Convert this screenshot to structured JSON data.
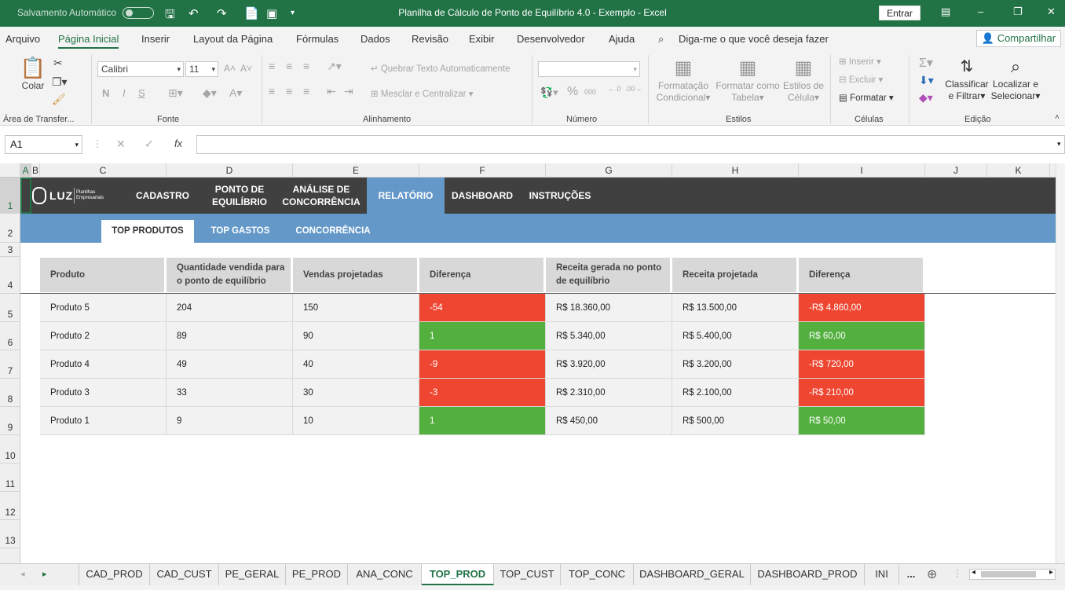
{
  "titlebar": {
    "autosave": "Salvamento Automático",
    "title": "Planilha de Cálculo de Ponto de Equilíbrio 4.0 - Exemplo  -  Excel",
    "enter": "Entrar"
  },
  "menu": {
    "items": [
      "Arquivo",
      "Página Inicial",
      "Inserir",
      "Layout da Página",
      "Fórmulas",
      "Dados",
      "Revisão",
      "Exibir",
      "Desenvolvedor",
      "Ajuda"
    ],
    "tell_me": "Diga-me o que você deseja fazer",
    "share": "Compartilhar"
  },
  "ribbon": {
    "paste": "Colar",
    "font_name": "Calibri",
    "font_size": "11",
    "bold": "N",
    "italic": "I",
    "underline": "S",
    "wrap": "Quebrar Texto Automaticamente",
    "merge": "Mesclar e Centralizar",
    "cond_format": [
      "Formatação",
      "Condicional"
    ],
    "format_table": [
      "Formatar como",
      "Tabela"
    ],
    "cell_styles": [
      "Estilos de",
      "Célula"
    ],
    "insert": "Inserir",
    "delete": "Excluir",
    "format": "Formatar",
    "sort": [
      "Classificar",
      "e Filtrar"
    ],
    "find": [
      "Localizar e",
      "Selecionar"
    ],
    "groups": {
      "clipboard": "Área de Transfer...",
      "font": "Fonte",
      "alignment": "Alinhamento",
      "number": "Número",
      "styles": "Estilos",
      "cells": "Células",
      "editing": "Edição"
    }
  },
  "formula": {
    "namebox": "A1",
    "fx": "fx"
  },
  "columns": [
    "A",
    "B",
    "C",
    "D",
    "E",
    "F",
    "G",
    "H",
    "I",
    "J",
    "K"
  ],
  "rows": [
    "1",
    "2",
    "3",
    "4",
    "5",
    "6",
    "7",
    "8",
    "9",
    "10",
    "11",
    "12",
    "13"
  ],
  "logo": {
    "main": "LUZ",
    "sub1": "Planilhas",
    "sub2": "Empresariais"
  },
  "nav": [
    "CADASTRO",
    "PONTO DE EQUILÍBRIO",
    "ANÁLISE DE CONCORRÊNCIA",
    "RELATÓRIO",
    "DASHBOARD",
    "INSTRUÇÕES"
  ],
  "subnav": [
    "TOP PRODUTOS",
    "TOP GASTOS",
    "CONCORRÊNCIA"
  ],
  "table": {
    "headers": [
      "Produto",
      "Quantidade vendida para o ponto de equilíbrio",
      "Vendas projetadas",
      "Diferença",
      "Receita gerada no ponto de equilíbrio",
      "Receita projetada",
      "Diferença"
    ],
    "rows": [
      [
        "Produto 5",
        "204",
        "150",
        "-54",
        "R$ 18.360,00",
        "R$ 13.500,00",
        "-R$ 4.860,00"
      ],
      [
        "Produto 2",
        "89",
        "90",
        "1",
        "R$ 5.340,00",
        "R$ 5.400,00",
        "R$ 60,00"
      ],
      [
        "Produto 4",
        "49",
        "40",
        "-9",
        "R$ 3.920,00",
        "R$ 3.200,00",
        "-R$ 720,00"
      ],
      [
        "Produto 3",
        "33",
        "30",
        "-3",
        "R$ 2.310,00",
        "R$ 2.100,00",
        "-R$ 210,00"
      ],
      [
        "Produto 1",
        "9",
        "10",
        "1",
        "R$ 450,00",
        "R$ 500,00",
        "R$ 50,00"
      ]
    ]
  },
  "sheets": [
    "CAD_PROD",
    "CAD_CUST",
    "PE_GERAL",
    "PE_PROD",
    "ANA_CONC",
    "TOP_PROD",
    "TOP_CUST",
    "TOP_CONC",
    "DASHBOARD_GERAL",
    "DASHBOARD_PROD",
    "INI",
    "..."
  ],
  "colors": {
    "excel_green": "#217346",
    "nav_dark": "#404040",
    "nav_blue": "#6498c8",
    "negative": "#ef4631",
    "positive": "#53b03f"
  }
}
